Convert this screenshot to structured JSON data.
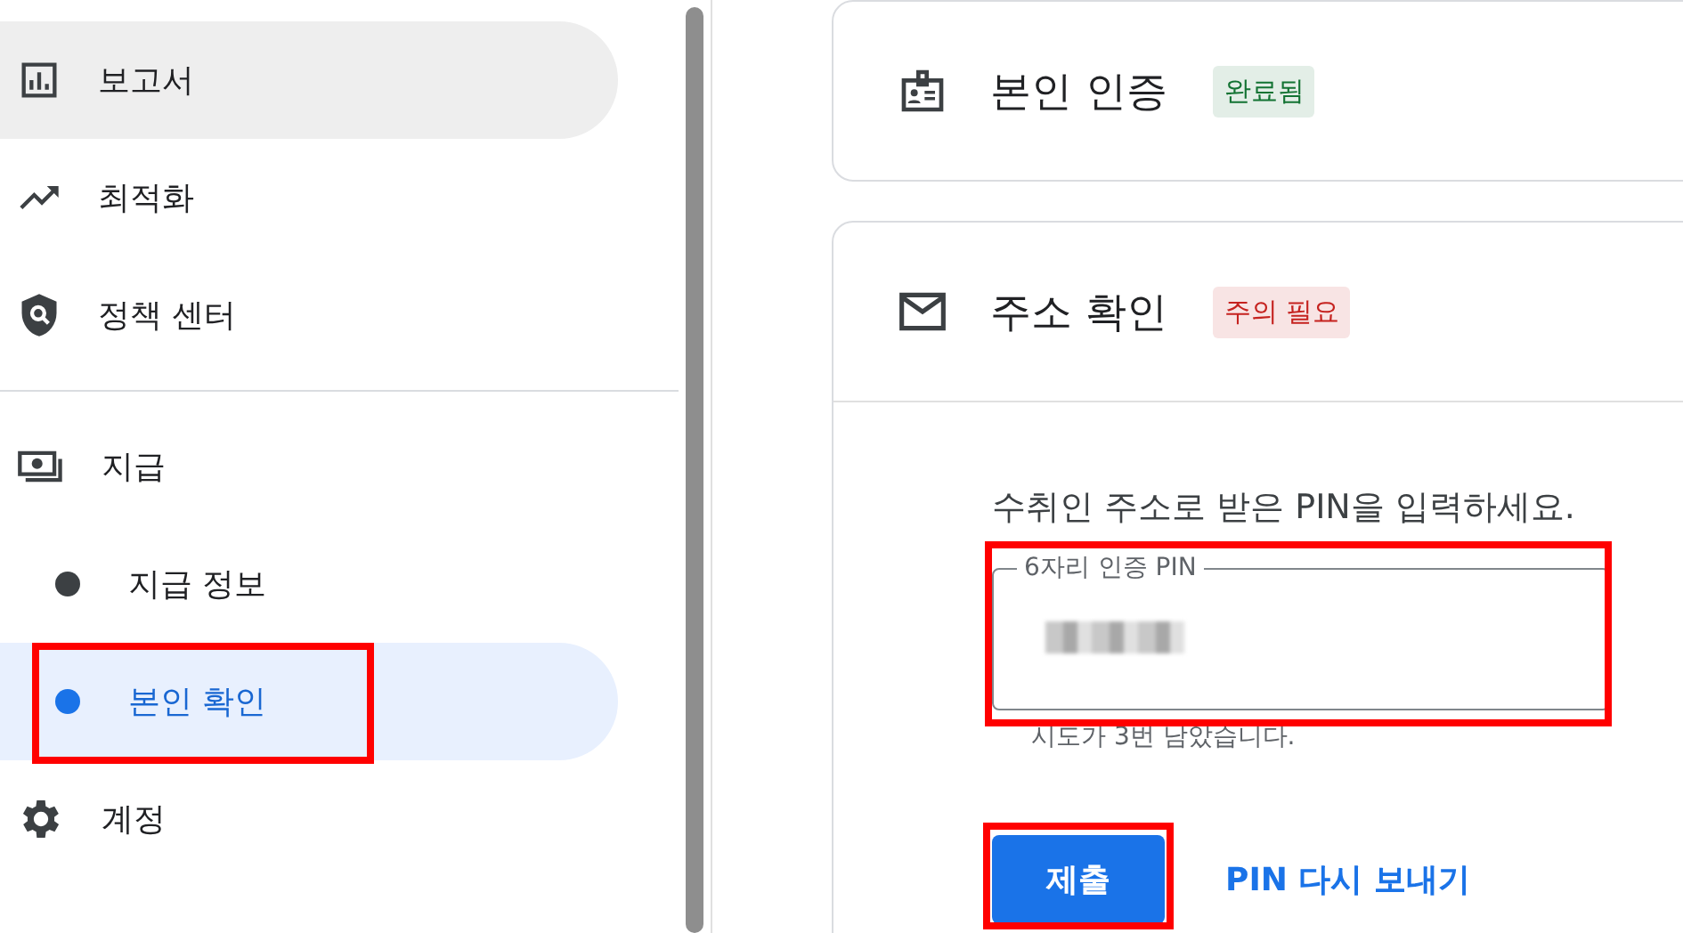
{
  "sidebar": {
    "groups": [
      {
        "items": [
          {
            "label": "보고서",
            "kind": "main",
            "selected": false,
            "hovered": true,
            "highlighted": false
          },
          {
            "label": "최적화",
            "kind": "main",
            "selected": false,
            "hovered": false,
            "highlighted": false
          },
          {
            "label": "정책 센터",
            "kind": "main",
            "selected": false,
            "hovered": false,
            "highlighted": false
          }
        ]
      },
      {
        "items": [
          {
            "label": "지급",
            "kind": "main",
            "selected": false,
            "hovered": false,
            "highlighted": false
          },
          {
            "label": "지급 정보",
            "kind": "sub",
            "selected": false,
            "hovered": false,
            "highlighted": false
          },
          {
            "label": "본인 확인",
            "kind": "sub",
            "selected": true,
            "hovered": false,
            "highlighted": true
          },
          {
            "label": "계정",
            "kind": "main",
            "selected": false,
            "hovered": false,
            "highlighted": false
          }
        ]
      }
    ]
  },
  "cards": [
    {
      "title": "본인 인증",
      "badge": {
        "text": "완료됨",
        "color": "#137333"
      }
    },
    {
      "title": "주소 확인",
      "badge": {
        "text": "주의 필요",
        "color": "#c5221f"
      },
      "instruction": "수취인 주소로 받은 PIN을 입력하세요.",
      "field": {
        "label": "6자리 인증 PIN",
        "masked": true,
        "highlighted": true
      },
      "helper": "시도가 3번 남았습니다.",
      "submit": {
        "label": "제출",
        "highlighted": true
      },
      "resend_link": "PIN 다시 보내기"
    }
  ]
}
